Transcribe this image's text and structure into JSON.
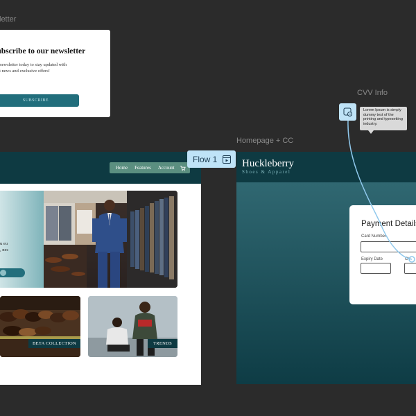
{
  "frames": {
    "newsletter_label": "letter",
    "homepage_cc_label": "Homepage + CC",
    "cvv_info_label": "CVV Info"
  },
  "newsletter": {
    "title": "Subscribe to our newsletter",
    "body_line1": "our newsletter today to stay updated with",
    "body_line2": "atest news and exclusive offers!",
    "button": "SUBSCRIBE"
  },
  "home": {
    "nav": [
      "Home",
      "Features",
      "Account"
    ],
    "hero_line1": "u eu",
    "hero_line2": ", nec",
    "tag_shoes": "BETA COLLECTION",
    "tag_trends": "TRENDS"
  },
  "flow": {
    "label": "Flow 1"
  },
  "homepage_cc": {
    "brand": "Huckleberry",
    "brand_sub": "Shoes & Apparel",
    "payment_title": "Payment Details",
    "card_number_label": "Card Number",
    "expiry_label": "Expiry Date",
    "cvv_label": "CV"
  },
  "cvv_tooltip": {
    "text": "Lorem Ipsum is simply dummy text of the printing and typesetting industry."
  },
  "colors": {
    "canvas": "#2b2b2b",
    "brand_teal": "#0e3a42",
    "accent_teal": "#226e7c",
    "flow_blue": "#bfe3f7"
  }
}
